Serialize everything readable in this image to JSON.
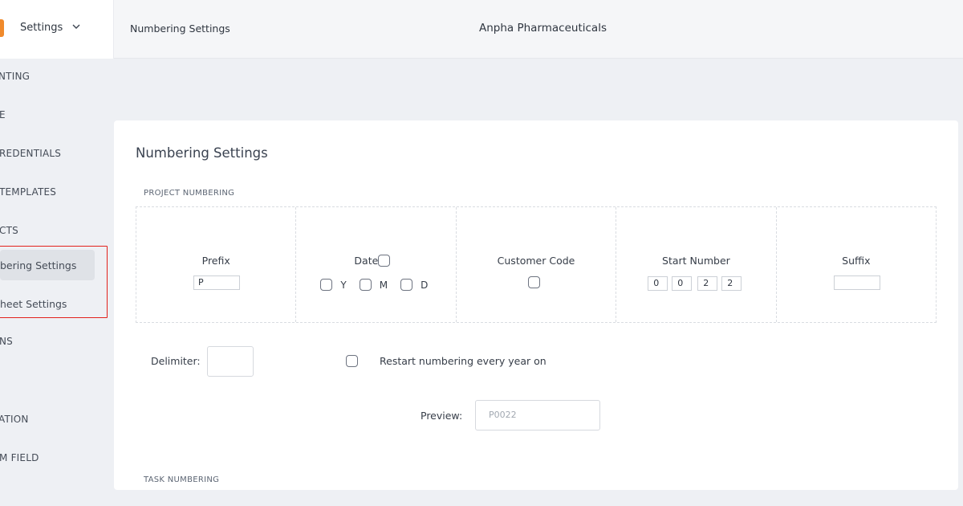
{
  "header": {
    "menu_label": "Settings",
    "page_title": "Numbering Settings",
    "company_name": "Anpha Pharmaceuticals"
  },
  "sidebar": {
    "items": [
      {
        "label": "NTING"
      },
      {
        "label": "E"
      },
      {
        "label": "REDENTIALS"
      },
      {
        "label": "TEMPLATES"
      },
      {
        "label": "CTS"
      },
      {
        "label": "bering Settings"
      },
      {
        "label": "heet Settings"
      },
      {
        "label": "NS"
      },
      {
        "label": "ATION"
      },
      {
        "label": "M FIELD"
      }
    ]
  },
  "panel": {
    "title": "Numbering Settings",
    "project_section": "PROJECT NUMBERING",
    "task_section": "TASK NUMBERING",
    "columns": {
      "prefix": {
        "label": "Prefix",
        "value": "P"
      },
      "date": {
        "label": "Date",
        "options": [
          "Y",
          "M",
          "D"
        ]
      },
      "customer_code": {
        "label": "Customer Code"
      },
      "start_number": {
        "label": "Start Number",
        "digits": [
          "0",
          "0",
          "2",
          "2"
        ]
      },
      "suffix": {
        "label": "Suffix",
        "value": ""
      }
    },
    "delimiter_label": "Delimiter:",
    "restart_label": "Restart numbering every year on",
    "preview_label": "Preview:",
    "preview_placeholder": "P0022"
  }
}
